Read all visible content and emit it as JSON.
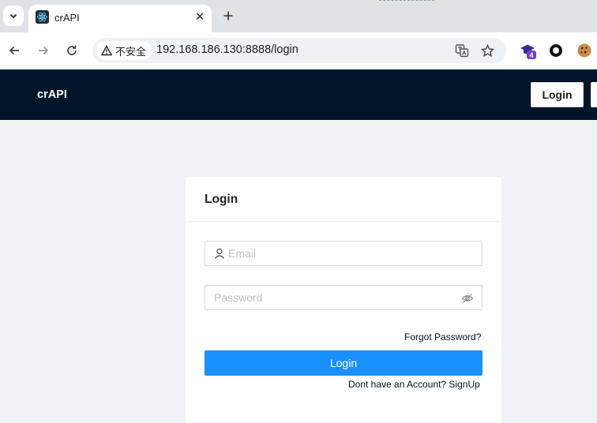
{
  "browser": {
    "tab_title": "crAPI",
    "url": "192.168.186.130:8888/login",
    "security_label": "不安全",
    "extension_badge": "4"
  },
  "app": {
    "brand": "crAPI",
    "nav": {
      "login_label": "Login"
    }
  },
  "login_card": {
    "title": "Login",
    "email_placeholder": "Email",
    "password_placeholder": "Password",
    "forgot_password": "Forgot Password?",
    "submit_label": "Login",
    "signup_link": "Dont have an Account? SignUp"
  },
  "colors": {
    "navbar": "#001529",
    "primary": "#1890ff",
    "page_bg": "#f0f2f5"
  }
}
